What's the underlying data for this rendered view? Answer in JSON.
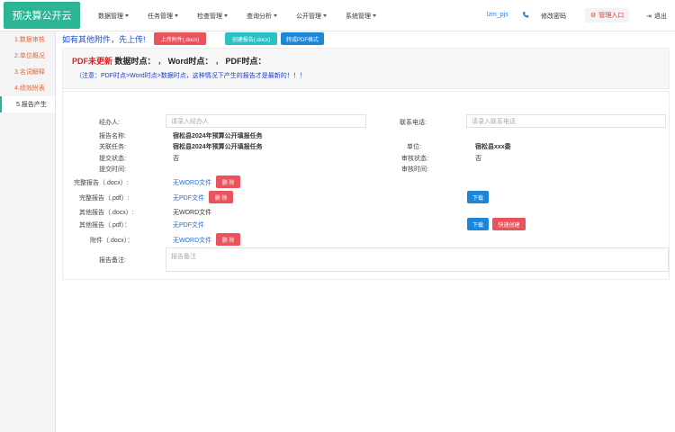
{
  "app": {
    "title": "预决算公开云"
  },
  "nav": [
    {
      "label": "数据管理"
    },
    {
      "label": "任务管理"
    },
    {
      "label": "检查管理"
    },
    {
      "label": "查询分析"
    },
    {
      "label": "公开管理"
    },
    {
      "label": "系统管理"
    }
  ],
  "header": {
    "user": "lzm_pjs",
    "change_password": "修改密码",
    "admin_entry": "管理入口",
    "logout": "退出"
  },
  "sidebar": {
    "items": [
      {
        "label": "1.数据审核"
      },
      {
        "label": "2.单位概况"
      },
      {
        "label": "3.名词解释"
      },
      {
        "label": "4.绩效附表"
      },
      {
        "label": "5.报告产生"
      }
    ]
  },
  "toolbar": {
    "attach_text": "如有其他附件，先上传!",
    "upload_label": "上传附件(.docx)",
    "create_report_label": "创建报告(.docx)",
    "convert_pdf_label": "转成PDF格式"
  },
  "notice": {
    "pdf_not_updated": "PDF未更新",
    "data_time_label": "数据时点：",
    "data_time_value": "，",
    "word_time_label": "Word时点：",
    "word_time_value": "，",
    "pdf_time_label": "PDF时点：",
    "note": "（注意：PDF时点>Word时点>数据时点，这种情况下产生的报告才是最新的！！！"
  },
  "form": {
    "handler_label": "经办人:",
    "handler_placeholder": "请录入经办人",
    "phone_label": "联系电话:",
    "phone_placeholder": "请录入联系电话",
    "report_name_label": "报告名称:",
    "report_name_value": "宿松县2024年预算公开填报任务",
    "related_task_label": "关联任务:",
    "related_task_value": "宿松县2024年预算公开填报任务",
    "unit_label": "单位:",
    "unit_value": "宿松县xxx委",
    "submit_status_label": "提交状态:",
    "submit_status_value": "否",
    "audit_status_label": "审核状态:",
    "audit_status_value": "否",
    "submit_time_label": "提交时间:",
    "audit_time_label": "审核时间:",
    "full_docx_label": "完整报告（.docx）:",
    "full_docx_value": "无WORD文件",
    "full_pdf_label": "完整报告（.pdf）:",
    "full_pdf_value": "无PDF文件",
    "other_docx_label": "其他报告（.docx）:",
    "other_docx_value": "无WORD文件",
    "other_pdf_label": "其他报告（.pdf）：",
    "other_pdf_value": "无PDF文件",
    "attach_docx_label": "附件（.docx）：",
    "attach_docx_value": "无WORD文件",
    "remark_label": "报告备注:",
    "remark_placeholder": "报告备注",
    "delete_label": "删 除",
    "download_label": "下载",
    "quick_create_label": "快速创建"
  },
  "colors": {
    "brand": "#2bb594",
    "danger": "#e9535b",
    "teal": "#29c1c5",
    "primary": "#1e86d6"
  }
}
